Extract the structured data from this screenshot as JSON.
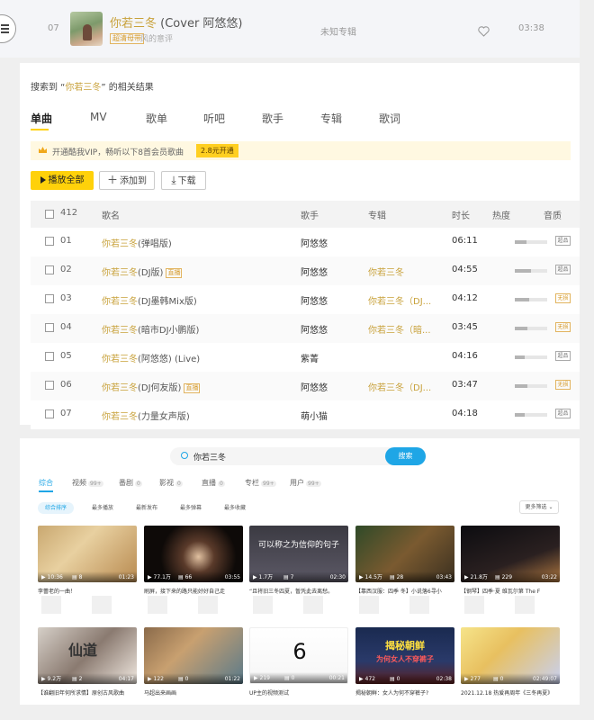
{
  "now_playing": {
    "index": "07",
    "title": "你若三冬",
    "title_suffix": "(Cover 阿悠悠)",
    "badge": "超清母带",
    "artist": "风的意评",
    "album": "未知专辑",
    "duration": "03:38"
  },
  "search_result": {
    "prefix": "搜索到 “",
    "query": "你若三冬",
    "suffix": "” 的相关结果",
    "tabs": [
      "单曲",
      "MV",
      "歌单",
      "听吧",
      "歌手",
      "专辑",
      "歌词"
    ],
    "vip_text": "开通酷我VIP，畅听以下8首会员歌曲",
    "vip_button": "2.8元开通",
    "play_all": "播放全部",
    "add_to": "添加到",
    "download": "下载",
    "columns": {
      "count": "412",
      "name": "歌名",
      "artist": "歌手",
      "album": "专辑",
      "duration": "时长",
      "heat": "热度",
      "quality": "音质"
    },
    "rows": [
      {
        "num": "01",
        "title": "你若三冬",
        "extra": "(弹唱版)",
        "tag": "",
        "artist": "阿悠悠",
        "album": "",
        "album_extra": "",
        "duration": "06:11",
        "heat": 0.35,
        "quality": "超品"
      },
      {
        "num": "02",
        "title": "你若三冬",
        "extra": "(DJ版)",
        "tag": "直播",
        "artist": "阿悠悠",
        "album": "你若三冬",
        "album_extra": "",
        "duration": "04:55",
        "heat": 0.5,
        "quality": "超品"
      },
      {
        "num": "03",
        "title": "你若三冬",
        "extra": "(DJ墨韩Mix版)",
        "tag": "",
        "artist": "阿悠悠",
        "album": "你若三冬",
        "album_extra": "（DJ...",
        "duration": "04:12",
        "heat": 0.45,
        "quality": "无损"
      },
      {
        "num": "04",
        "title": "你若三冬",
        "extra": "(暗市DJ小鹏版)",
        "tag": "",
        "artist": "阿悠悠",
        "album": "你若三冬",
        "album_extra": "（暗...",
        "duration": "03:45",
        "heat": 0.4,
        "quality": "无损"
      },
      {
        "num": "05",
        "title": "你若三冬",
        "extra": "(阿悠悠) (Live)",
        "tag": "",
        "artist": "紫菁",
        "album": "",
        "album_extra": "",
        "duration": "04:16",
        "heat": 0.3,
        "quality": "超品"
      },
      {
        "num": "06",
        "title": "你若三冬",
        "extra": "(DJ何友版)",
        "tag": "直播",
        "artist": "阿悠悠",
        "album": "你若三冬",
        "album_extra": "（DJ...",
        "duration": "03:47",
        "heat": 0.38,
        "quality": "无损"
      },
      {
        "num": "07",
        "title": "你若三冬",
        "extra": "(力量女声版)",
        "tag": "",
        "artist": "萌小猫",
        "album": "",
        "album_extra": "",
        "duration": "04:18",
        "heat": 0.3,
        "quality": "超品"
      }
    ]
  },
  "video_search": {
    "query": "你若三冬",
    "button": "搜索",
    "tabs": [
      {
        "label": "综合",
        "count": ""
      },
      {
        "label": "视频",
        "count": "99+"
      },
      {
        "label": "番剧",
        "count": "0"
      },
      {
        "label": "影视",
        "count": "0"
      },
      {
        "label": "直播",
        "count": "0"
      },
      {
        "label": "专栏",
        "count": "99+"
      },
      {
        "label": "用户",
        "count": "99+"
      }
    ],
    "filters": [
      "综合排序",
      "最多播放",
      "最新发布",
      "最多弹幕",
      "最多收藏"
    ],
    "more_filter": "更多筛选",
    "cards": [
      {
        "views": "10:36",
        "comments": "8",
        "duration": "01:23",
        "caption": "李蕾老的一曲！"
      },
      {
        "views": "77.1万",
        "comments": "66",
        "duration": "03:55",
        "caption": "刷屏，接下来的路只能好好自己走"
      },
      {
        "views": "1.7万",
        "comments": "7",
        "duration": "02:30",
        "caption": "“且将旧三冬四夏，暂凭此去离愁。"
      },
      {
        "views": "14.5万",
        "comments": "28",
        "duration": "03:43",
        "caption": "【靠西汉服：四季 冬】小说落6寻小"
      },
      {
        "views": "21.8万",
        "comments": "229",
        "duration": "03:22",
        "caption": "【钢琴】四季·夏 维瓦尔第 The F"
      },
      {
        "views": "9.2万",
        "comments": "2",
        "duration": "04:17",
        "caption": "【谁翻旧年何所求情】原创古风歌曲"
      },
      {
        "views": "122",
        "comments": "0",
        "duration": "01:22",
        "caption": "马超出来画画"
      },
      {
        "views": "219",
        "comments": "0",
        "duration": "00:21",
        "caption": "UP主的视频测试"
      },
      {
        "views": "472",
        "comments": "0",
        "duration": "02:38",
        "caption": "揭秘朝鲜：女人为何不穿裤子?"
      },
      {
        "views": "277",
        "comments": "0",
        "duration": "02:49:07",
        "caption": "2021.12.18 热爱再周年《三冬再夏》"
      }
    ],
    "thumb_texts": {
      "c3": "可以称之为信仰的句子",
      "c8": "6",
      "c9_line1": "揭秘朝鲜",
      "c9_line2": "为何女人不穿裤子",
      "c6": "仙道"
    }
  }
}
